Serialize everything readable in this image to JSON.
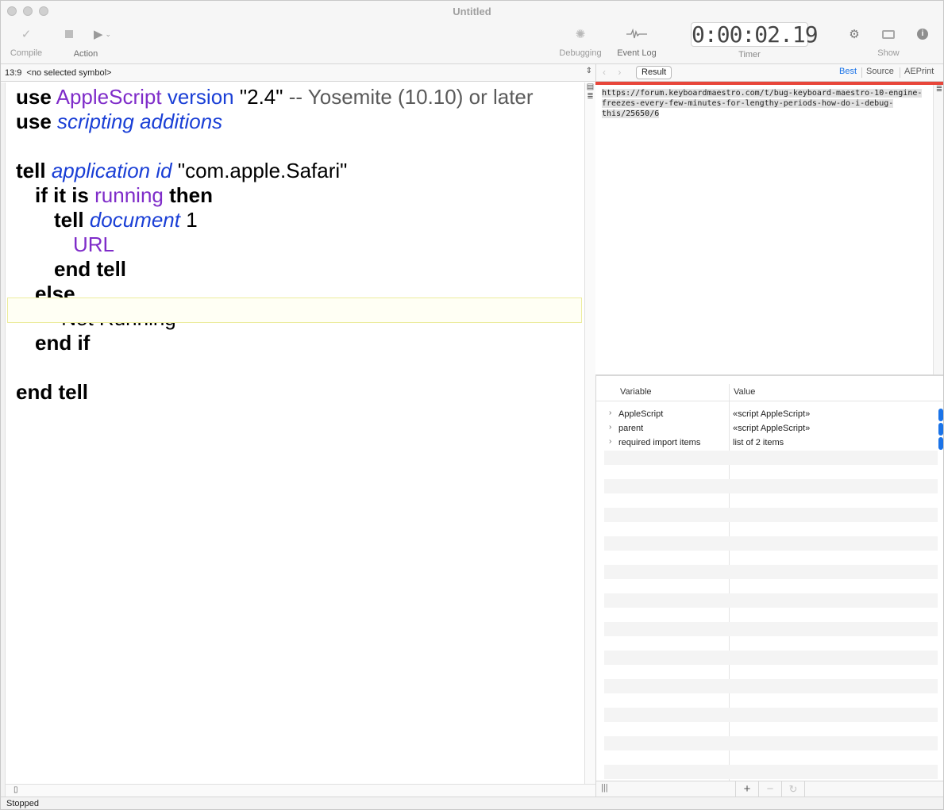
{
  "window": {
    "title": "Untitled"
  },
  "toolbar": {
    "compile_label": "Compile",
    "action_label": "Action",
    "debugging_label": "Debugging",
    "event_log_label": "Event Log",
    "timer_value": "0:00:02.19",
    "timer_label": "Timer",
    "show_label": "Show"
  },
  "navbar": {
    "position": "13:9",
    "symbol": "<no selected symbol>"
  },
  "code_lines": [
    [
      "use",
      "AppleScript",
      "version",
      "\"2.4\"",
      "-- Yosemite (10.10) or later"
    ],
    [
      "use",
      "scripting additions"
    ],
    [],
    [
      "tell",
      "application",
      "id",
      "\"com.apple.Safari\""
    ],
    [
      "if it is",
      "running",
      "then"
    ],
    [
      "tell",
      "document",
      "1"
    ],
    [
      "URL"
    ],
    [
      "end tell"
    ],
    [
      "else"
    ],
    [
      "\"Not Running\""
    ],
    [
      "end if"
    ],
    [],
    [
      "end tell"
    ]
  ],
  "result_pane": {
    "result_button": "Result",
    "segments": [
      "Best",
      "Source",
      "AEPrint"
    ],
    "active_segment": "Best",
    "result_text": "https://forum.keyboardmaestro.com/t/bug-keyboard-maestro-10-engine-freezes-every-few-minutes-for-lengthy-periods-how-do-i-debug-this/25650/6"
  },
  "variables": {
    "columns": [
      "Variable",
      "Value"
    ],
    "rows": [
      {
        "name": "AppleScript",
        "value": "«script AppleScript»"
      },
      {
        "name": "parent",
        "value": "«script AppleScript»"
      },
      {
        "name": "required import items",
        "value": "list of 2 items"
      }
    ]
  },
  "footer": {
    "add": "+",
    "remove": "−"
  },
  "status": {
    "text": "Stopped"
  },
  "colors": {
    "accent": "#1a73e8",
    "result_rule": "#e8463a",
    "keyword_class": "#7f2cc9",
    "keyword_command": "#1a3fd6"
  }
}
